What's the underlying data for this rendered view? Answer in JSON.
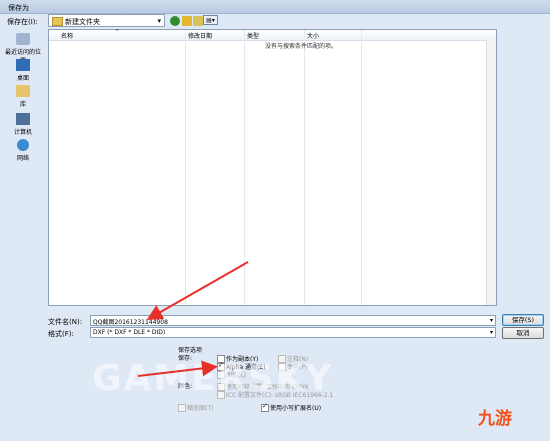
{
  "window": {
    "title": "保存为"
  },
  "lookin": {
    "label": "保存在(I):",
    "value": "新建文件夹"
  },
  "nav": {
    "items": [
      {
        "label": "最近访问的位置"
      },
      {
        "label": "桌面"
      },
      {
        "label": "库"
      },
      {
        "label": "计算机"
      },
      {
        "label": "网络"
      }
    ]
  },
  "list": {
    "columns": [
      "名称",
      "修改日期",
      "类型",
      "大小"
    ],
    "empty_message": "没有与搜索条件匹配的项。"
  },
  "filename": {
    "label": "文件名(N):",
    "value": "QQ截图20161231144908"
  },
  "format": {
    "label": "格式(F):",
    "value": "DXF (* DXF * DLE * DID)"
  },
  "buttons": {
    "save": "保存(S)",
    "cancel": "取消"
  },
  "options": {
    "section_label": "保存选项",
    "save_label": "保存:",
    "as_copy": "作为副本(Y)",
    "notes": "注释(N)",
    "alpha": "Alpha 通道(E)",
    "spot": "专色(P)",
    "layers": "图层(L)",
    "color_label": "颜色:",
    "proof": "使用校样设置: 工作中的 CMYK",
    "icc": "ICC 配置文件(C): sRGB IEC61966-2.1",
    "thumbnail": "缩览图(T)",
    "lowercase_ext": "使用小写扩展名(U)"
  },
  "watermark": "GAMERSKY",
  "logo": "九游",
  "colors": {
    "arrow": "#e8302a",
    "accent": "#3c7fb1"
  }
}
